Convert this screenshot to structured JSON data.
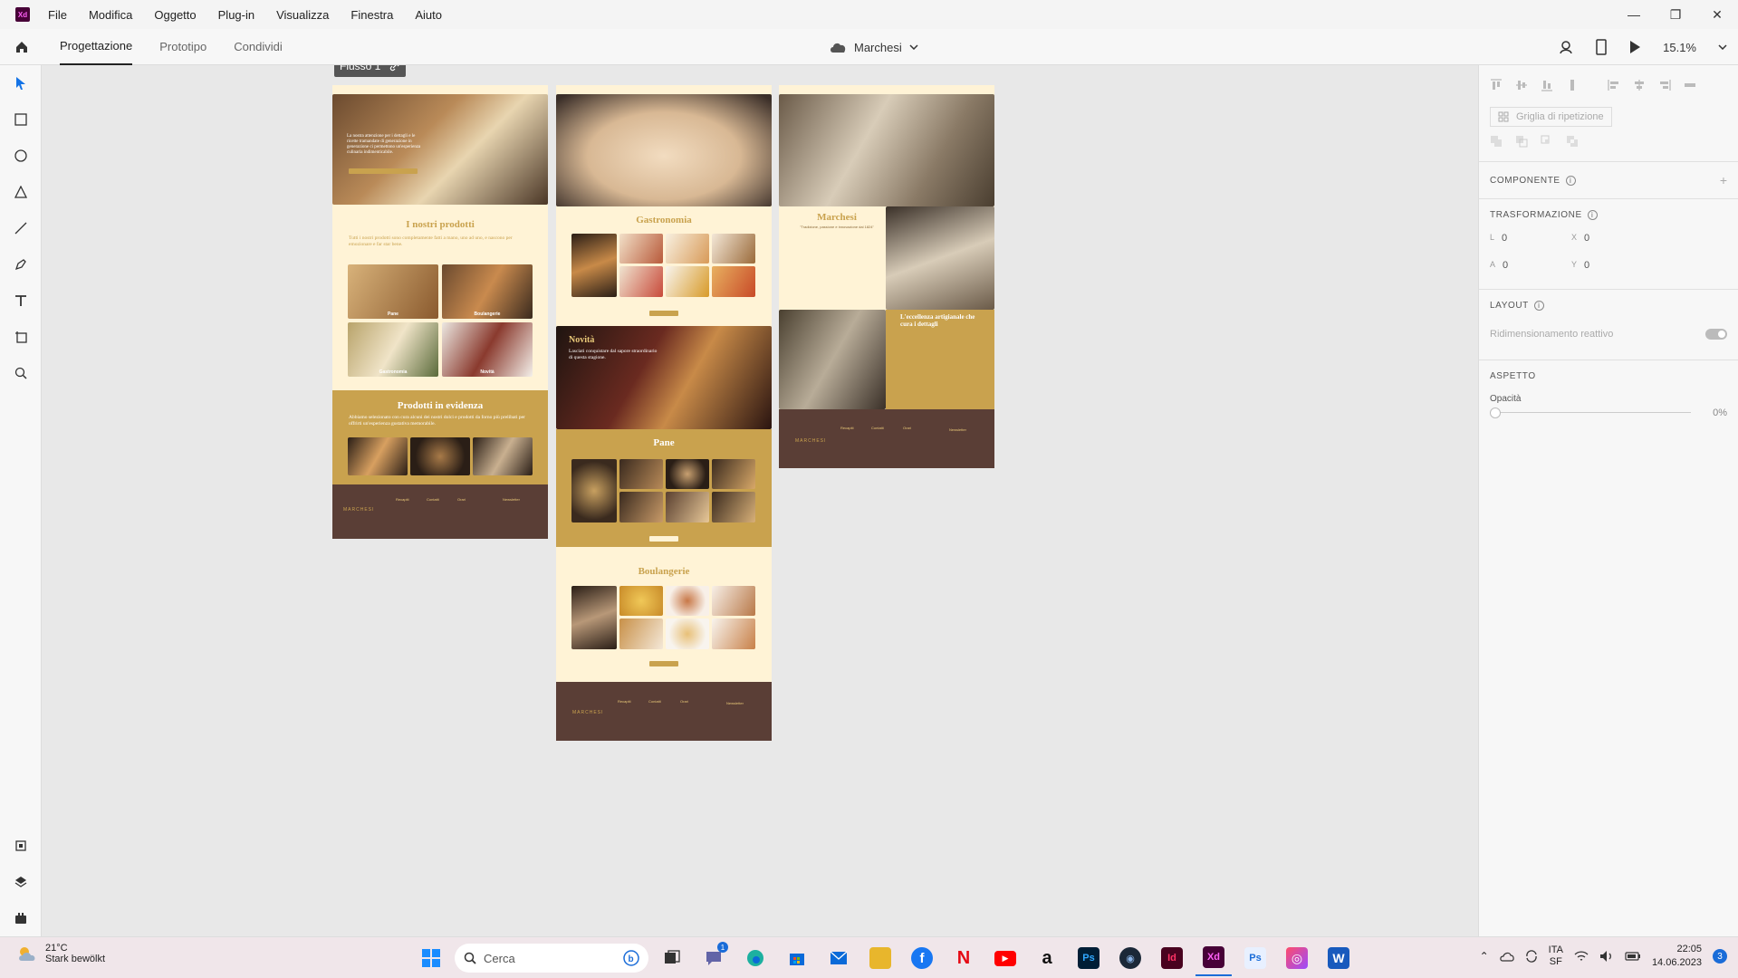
{
  "menubar": {
    "app_badge": "Xd",
    "items": [
      "File",
      "Modifica",
      "Oggetto",
      "Plug-in",
      "Visualizza",
      "Finestra",
      "Aiuto"
    ],
    "controls": [
      "—",
      "❐",
      "✕"
    ]
  },
  "appbar": {
    "tabs": [
      "Progettazione",
      "Prototipo",
      "Condividi"
    ],
    "document_name": "Marchesi",
    "zoom": "15.1%"
  },
  "flow": {
    "label": "Flusso 1"
  },
  "artboards": {
    "home": {
      "hero_text": "La nostra attenzione per i dettagli e le ricette tramandate di generazione in generazione ci permettono un'esperienza culinaria indimenticabile.",
      "products_title": "I nostri prodotti",
      "products_text": "Tutti i nostri prodotti sono completamente fatti a mano, uno ad uno, e nascono per emozionare e far star bene.",
      "categories": [
        "Pane",
        "Boulangerie",
        "Gastronomia",
        "Novità"
      ],
      "featured_title": "Prodotti in evidenza",
      "featured_text": "Abbiamo selezionato con cura alcuni dei nostri dolci e prodotti da forno più prelibati per offrirti un'esperienza gustativa memorabile.",
      "brand": "MARCHESI",
      "footer_cols": [
        "Recapiti",
        "Contatti",
        "Orari",
        "Newsletter"
      ]
    },
    "products": {
      "sections": [
        "Gastronomia",
        "Pane",
        "Boulangerie"
      ],
      "novita_title": "Novità",
      "novita_text": "Lasciati conquistare dal sapore straordinario di questa stagione.",
      "brand": "MARCHESI",
      "footer_cols": [
        "Recapiti",
        "Contatti",
        "Orari",
        "Newsletter"
      ]
    },
    "about": {
      "title": "Marchesi",
      "subtitle": "\"Tradizione, passione e innovazione dal 1824\"",
      "excellence_title": "L'eccellenza artigianale che cura i dettagli",
      "brand": "MARCHESI",
      "footer_cols": [
        "Recapiti",
        "Contatti",
        "Orari",
        "Newsletter"
      ]
    }
  },
  "panel": {
    "repeat_grid": "Griglia di ripetizione",
    "component": "COMPONENTE",
    "transform": "TRASFORMAZIONE",
    "fields": [
      {
        "label": "L",
        "value": "0"
      },
      {
        "label": "X",
        "value": "0"
      },
      {
        "label": "A",
        "value": "0"
      },
      {
        "label": "Y",
        "value": "0"
      }
    ],
    "layout": "LAYOUT",
    "responsive": "Ridimensionamento reattivo",
    "appearance": "ASPETTO",
    "opacity_label": "Opacità",
    "opacity_value": "0%"
  },
  "taskbar": {
    "weather_temp": "21°C",
    "weather_desc": "Stark bewölkt",
    "search_placeholder": "Cerca",
    "lang_top": "ITA",
    "lang_bottom": "SF",
    "time": "22:05",
    "date": "14.06.2023",
    "notifications": "3",
    "teams_badge": "1",
    "apps": [
      {
        "name": "file-explorer-icon",
        "color": "#e8b62c",
        "glyph": ""
      },
      {
        "name": "facebook-icon",
        "color": "#1877f2",
        "glyph": "f"
      },
      {
        "name": "netflix-icon",
        "color": "#ffffff",
        "glyph": "N"
      },
      {
        "name": "youtube-icon",
        "color": "#ff0000",
        "glyph": "▶"
      },
      {
        "name": "amazon-icon",
        "color": "#ffffff",
        "glyph": "a"
      },
      {
        "name": "photoshop-icon",
        "color": "#001e36",
        "glyph": "Ps"
      },
      {
        "name": "steam-icon",
        "color": "#1b2838",
        "glyph": "◉"
      },
      {
        "name": "indesign-icon",
        "color": "#49021f",
        "glyph": "Id"
      },
      {
        "name": "xd-icon",
        "color": "#470137",
        "glyph": "Xd"
      },
      {
        "name": "photoshop-express-icon",
        "color": "#e8f0ff",
        "glyph": "Ps"
      },
      {
        "name": "creative-cloud-icon",
        "color": "#ff4c6a",
        "glyph": "◎"
      },
      {
        "name": "word-icon",
        "color": "#185abd",
        "glyph": "W"
      }
    ]
  }
}
